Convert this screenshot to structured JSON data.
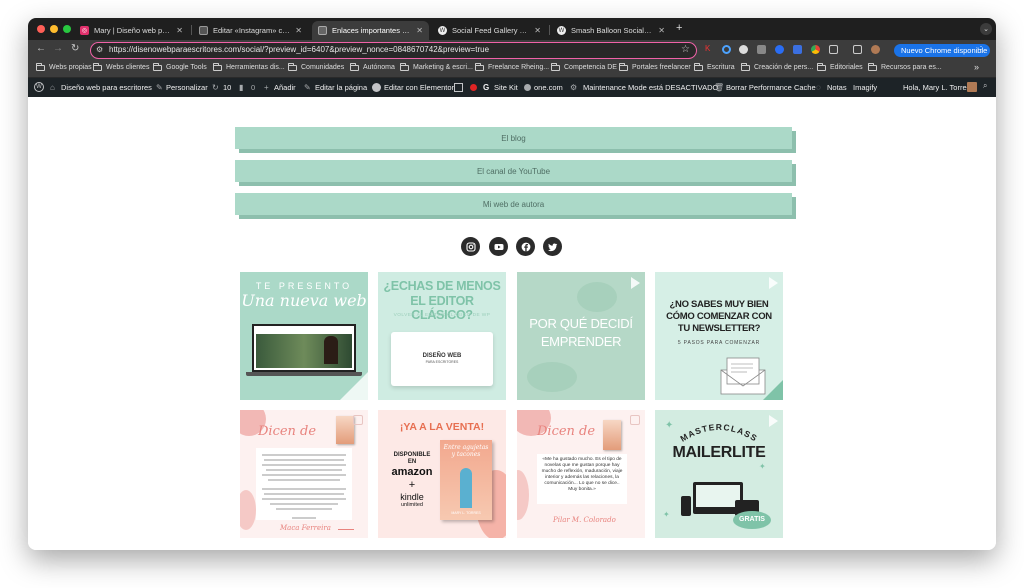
{
  "browser": {
    "tabs": [
      {
        "title": "Mary | Diseño web para escri",
        "active": false,
        "favicon": "instagram-icon"
      },
      {
        "title": "Editar «Instagram» con Elem",
        "active": false,
        "favicon": "elementor-icon"
      },
      {
        "title": "Enlaces importantes | Diseño",
        "active": true,
        "favicon": "site-icon"
      },
      {
        "title": "Social Feed Gallery – WordPr",
        "active": false,
        "favicon": "wordpress-icon"
      },
      {
        "title": "Smash Balloon Social Photo F",
        "active": false,
        "favicon": "wordpress-icon"
      }
    ],
    "new_tab": "+",
    "url": "https://disenowebparaescritores.com/social/?preview_id=6407&preview_nonce=0848670742&preview=true",
    "update_button": "Nuevo Chrome disponible",
    "bookmarks": [
      "Webs propias",
      "Webs clientes",
      "Google Tools",
      "Herramientas dis...",
      "Comunidades",
      "Autónoma",
      "Marketing & escri...",
      "Freelance Rheing...",
      "Competencia DE",
      "Portales freelancer",
      "Escritura",
      "Creación de pers...",
      "Editoriales",
      "Recursos para es..."
    ],
    "bookmarks_more": "»"
  },
  "adminbar": {
    "site_name": "Diseño web para escritores",
    "customize": "Personalizar",
    "updates": "10",
    "comments": "0",
    "add_new": "Añadir",
    "edit_page": "Editar la página",
    "edit_elementor": "Editar con Elementor",
    "site_kit": "Site Kit",
    "onecom": "one.com",
    "maintenance": "Maintenance Mode está DESACTIVADO",
    "purge_cache": "Borrar Performance Cache",
    "notes": "Notas",
    "imagify": "Imagify",
    "greeting": "Hola, Mary L. Torres"
  },
  "links": [
    "El blog",
    "El canal de YouTube",
    "Mi web de autora"
  ],
  "social_icons": [
    "instagram-icon",
    "youtube-icon",
    "facebook-icon",
    "twitter-icon"
  ],
  "feed": {
    "t1": {
      "line1": "TE PRESENTO",
      "line2": "Una nueva web"
    },
    "t2": {
      "line1": "¿ECHAS DE MENOS",
      "line2": "EL EDITOR CLÁSICO?",
      "sub": "VOLVER AL EDITOR CLÁSICO DE WP",
      "logo1": "DISEÑO WEB",
      "logo2": "PARA ESCRITORES"
    },
    "t3": {
      "line1": "POR QUÉ DECIDÍ",
      "line2": "EMPRENDER"
    },
    "t4": {
      "line1": "¿NO SABES MUY BIEN",
      "line2": "CÓMO COMENZAR CON",
      "line3": "TU NEWSLETTER?",
      "sub": "5 PASOS PARA COMENZAR"
    },
    "t5": {
      "title": "Dicen de",
      "signature": "Maca Ferreira"
    },
    "t6": {
      "title": "¡YA A LA VENTA!",
      "avail1": "DISPONIBLE",
      "avail2": "EN",
      "amazon": "amazon",
      "plus": "+",
      "kindle": "kindle",
      "unlimited": "unlimited",
      "cover_title": "Entre agujetas y tacones",
      "author": "MARY L. TORRES"
    },
    "t7": {
      "title": "Dicen de",
      "quote": "«Me ha gustado mucho. Es el tipo de novelas que me gustan porque hay mucho de reflexión, maduración, viaje interior y además las relaciones, la comunicación... Lo que no se dice.. Muy bonita.»",
      "signature": "Pilar M. Colorado"
    },
    "t8": {
      "line1": "MASTERCLASS",
      "line2": "MAILERLITE",
      "badge": "GRATIS"
    }
  }
}
